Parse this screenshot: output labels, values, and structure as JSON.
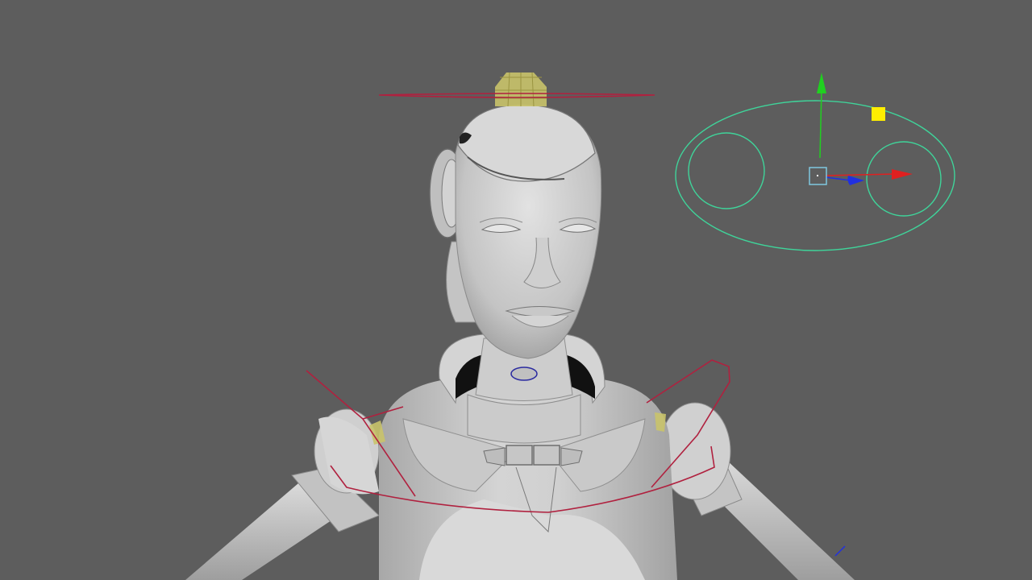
{
  "viewport": {
    "background_color": "#5d5d5d",
    "model_color": "#c8c8c8",
    "model_shadow_color": "#9a9a9a",
    "control_curve_color": "#b0213f",
    "selected_curve_color": "#3fd49a",
    "joint_color": "#c9c36a",
    "manipulator": {
      "x_axis_color": "#e02020",
      "y_axis_color": "#20d020",
      "z_axis_color": "#2030e0",
      "center_color": "#7fc8e0",
      "handle_color": "#ffee00",
      "x_axis_icon": "arrow-right-icon",
      "y_axis_icon": "arrow-up-icon",
      "z_axis_icon": "arrow-diagonal-icon"
    }
  }
}
